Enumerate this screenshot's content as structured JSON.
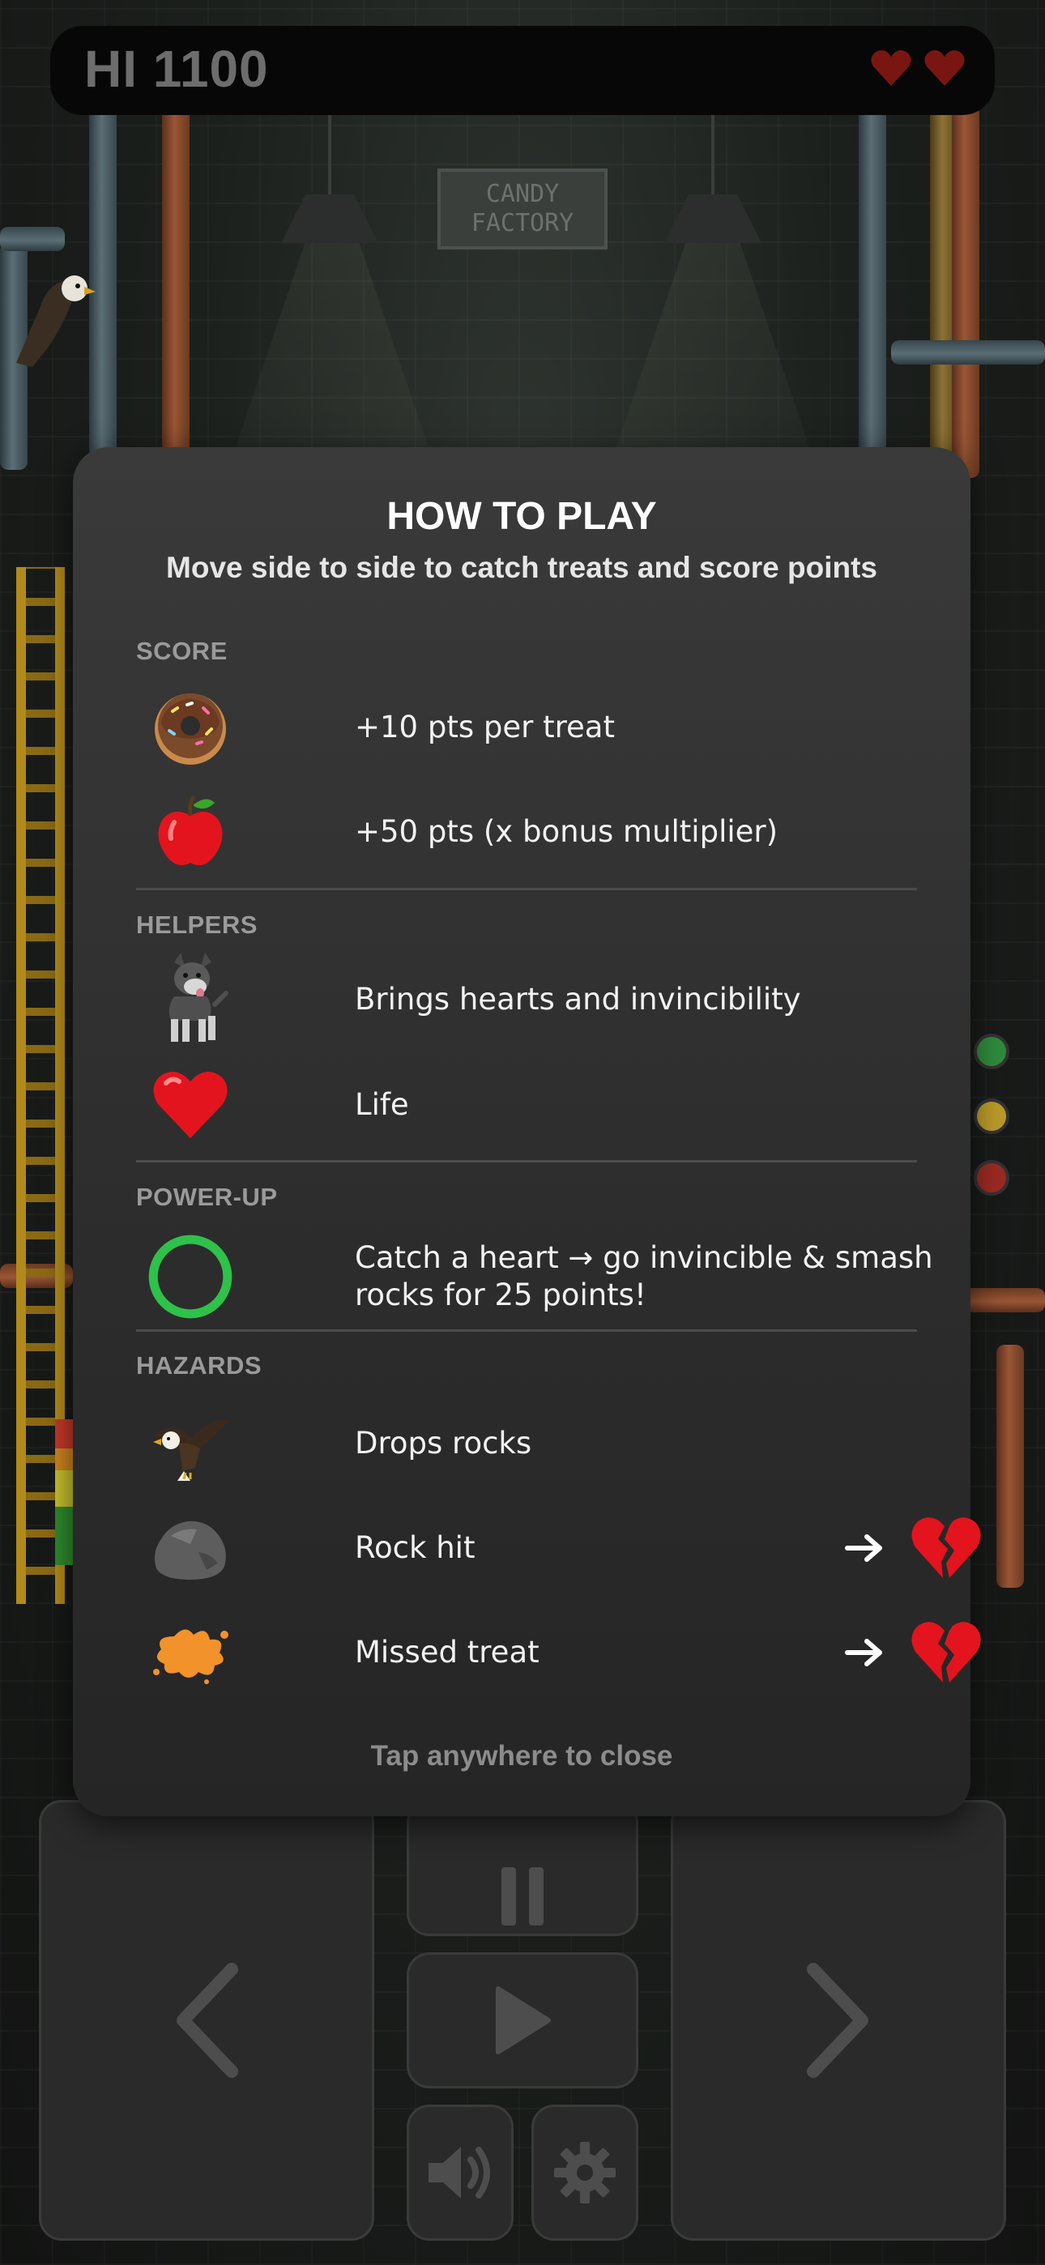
{
  "hud": {
    "high_score": "HI 1100",
    "lives": 2
  },
  "scene": {
    "sign": [
      "CANDY",
      "FACTORY"
    ]
  },
  "modal": {
    "title": "HOW TO PLAY",
    "subtitle": "Move side to side to catch treats and score points",
    "close_hint": "Tap anywhere to close",
    "sections": {
      "score": {
        "heading": "SCORE",
        "items": [
          {
            "icon": "donut-icon",
            "text": "+10 pts per treat"
          },
          {
            "icon": "apple-icon",
            "text": "+50 pts (x bonus multiplier)"
          }
        ]
      },
      "helpers": {
        "heading": "HELPERS",
        "items": [
          {
            "icon": "dog-icon",
            "text": "Brings hearts and invincibility"
          },
          {
            "icon": "heart-icon",
            "text": "Life"
          }
        ]
      },
      "powerup": {
        "heading": "POWER-UP",
        "items": [
          {
            "icon": "green-ring-icon",
            "line1": "Catch a heart → go invincible & smash",
            "line2": "rocks for 25 points!"
          }
        ]
      },
      "hazards": {
        "heading": "HAZARDS",
        "items": [
          {
            "icon": "eagle-icon",
            "text": "Drops rocks"
          },
          {
            "icon": "rock-icon",
            "text": "Rock hit",
            "result": "broken-heart-icon"
          },
          {
            "icon": "splat-icon",
            "text": "Missed treat",
            "result": "broken-heart-icon"
          }
        ]
      }
    }
  },
  "controls": {
    "left": "chevron-left-icon",
    "right": "chevron-right-icon",
    "pause": "pause-icon",
    "play": "play-icon",
    "sound": "speaker-icon",
    "settings": "gear-icon"
  },
  "colors": {
    "modal_bg": "#333333",
    "accent_green": "#2ec24a",
    "heart_red": "#e3141e"
  }
}
